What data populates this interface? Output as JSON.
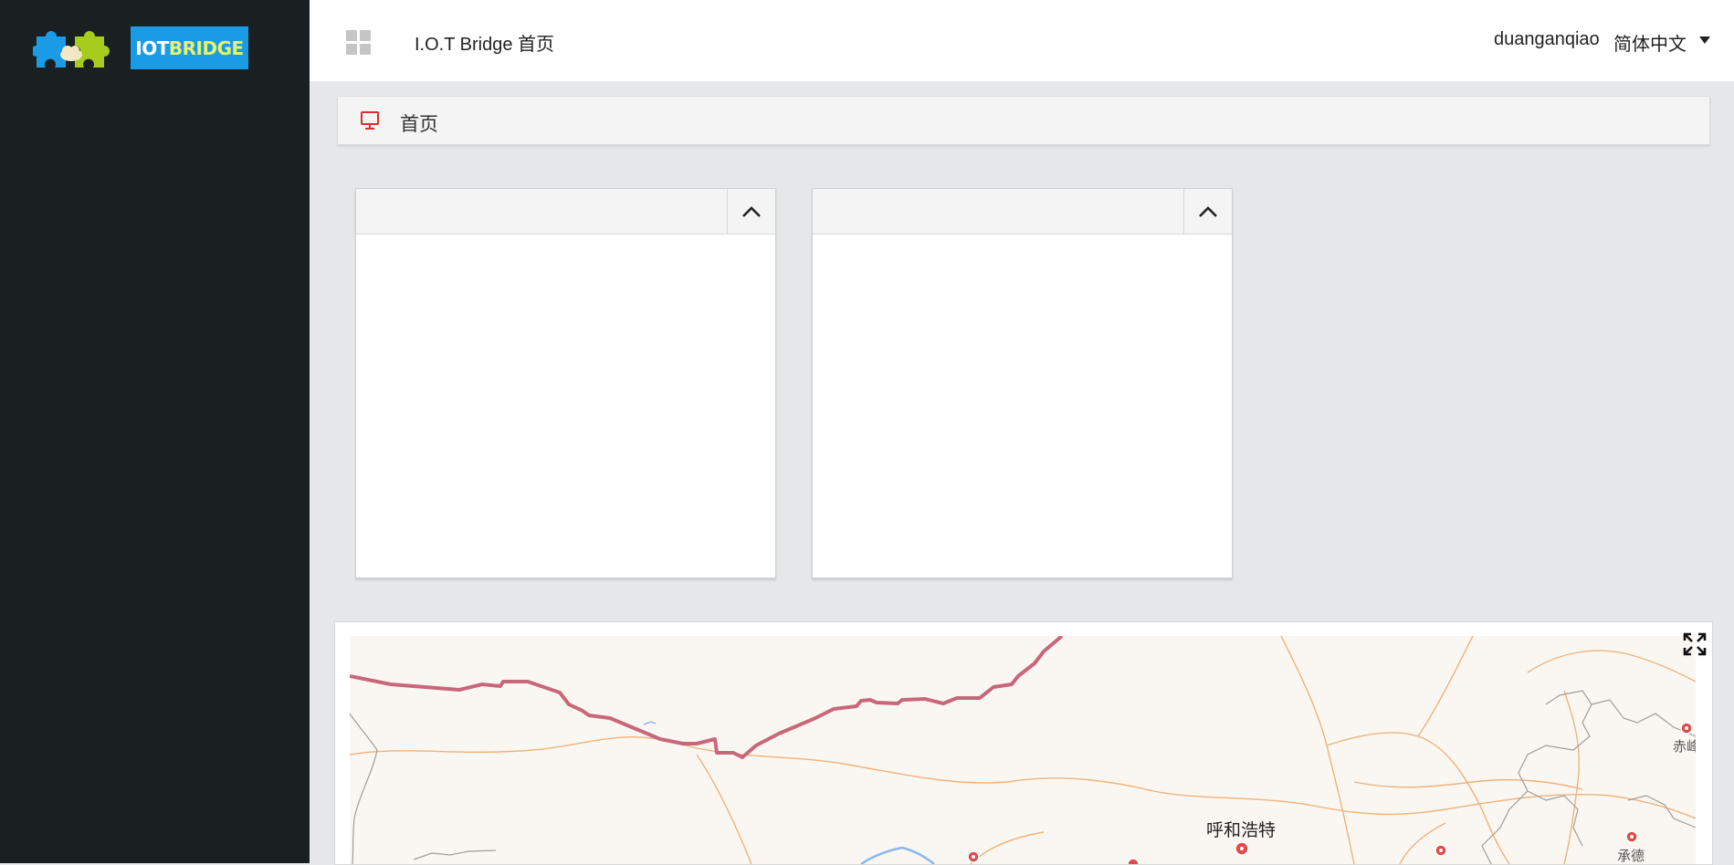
{
  "brand": {
    "logo_text_part1": "IOT",
    "logo_text_part2": "BRIDGE",
    "colors": {
      "blue": "#1a9be6",
      "green": "#a8cc1c",
      "accent_text": "#e8f26a"
    }
  },
  "header": {
    "menu_icon": "grid-icon",
    "title": "I.O.T Bridge 首页",
    "username": "duanganqiao",
    "language": "简体中文",
    "language_caret_icon": "caret-down-icon"
  },
  "breadcrumb": {
    "icon": "monitor-icon",
    "icon_color": "#d9302c",
    "label": "首页"
  },
  "panels": [
    {
      "title": "",
      "toggle_icon": "chevron-up-icon"
    },
    {
      "title": "",
      "toggle_icon": "chevron-up-icon"
    }
  ],
  "map": {
    "fullscreen_icon": "fullscreen-icon",
    "cities": [
      {
        "name": "呼和浩特",
        "major": true
      },
      {
        "name": "赤峰",
        "major": false
      },
      {
        "name": "承德",
        "major": false
      }
    ],
    "colors": {
      "border": "#c9677a",
      "road": "#f0b27a",
      "admin": "#9e9e9e",
      "river": "#8ab8f0",
      "marker": "#e04a4a"
    }
  }
}
